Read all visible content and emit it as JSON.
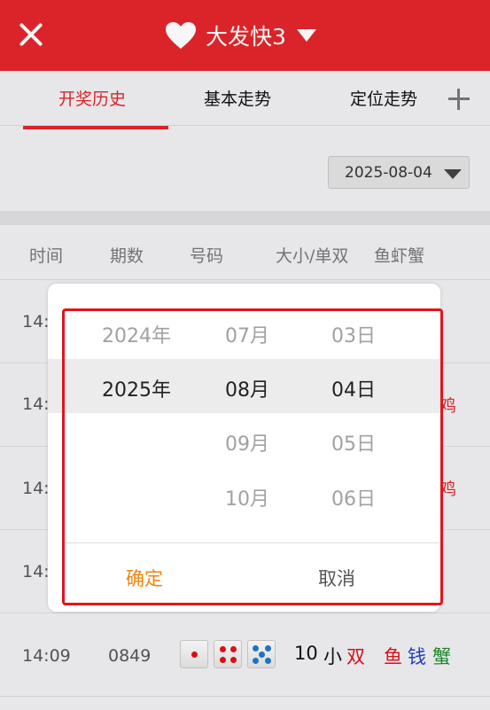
{
  "header": {
    "title": "大发快3"
  },
  "tabs": [
    {
      "label": "开奖历史"
    },
    {
      "label": "基本走势"
    },
    {
      "label": "定位走势"
    }
  ],
  "filter": {
    "date": "2025-08-04"
  },
  "columns": [
    "时间",
    "期数",
    "号码",
    "大小/单双",
    "鱼虾蟹"
  ],
  "rows": [
    {
      "time": "14:",
      "tail": ""
    },
    {
      "time": "14:",
      "tail": "鸡"
    },
    {
      "time": "14:",
      "tail": "鸡"
    },
    {
      "time": "14:",
      "tail": ""
    }
  ],
  "last_row": {
    "time": "14:09",
    "issue": "0849",
    "dice": [
      1,
      4,
      5
    ],
    "sum": "10",
    "size": "小",
    "parity": "双",
    "symbols": [
      "鱼",
      "钱",
      "蟹"
    ]
  },
  "picker": {
    "years": [
      "2024年",
      "2025年"
    ],
    "months": [
      "07月",
      "08月",
      "09月",
      "10月"
    ],
    "days": [
      "03日",
      "04日",
      "05日",
      "06日"
    ],
    "selected": {
      "year": "2025年",
      "month": "08月",
      "day": "04日"
    },
    "confirm": "确定",
    "cancel": "取消"
  },
  "colors": {
    "header_red": "#e3262b",
    "confirm_orange": "#f0840e",
    "parity_red": "#e0101a",
    "symbol_red": "#e0101a",
    "symbol_blue": "#1f3fbf",
    "symbol_green": "#1d8a2c"
  }
}
